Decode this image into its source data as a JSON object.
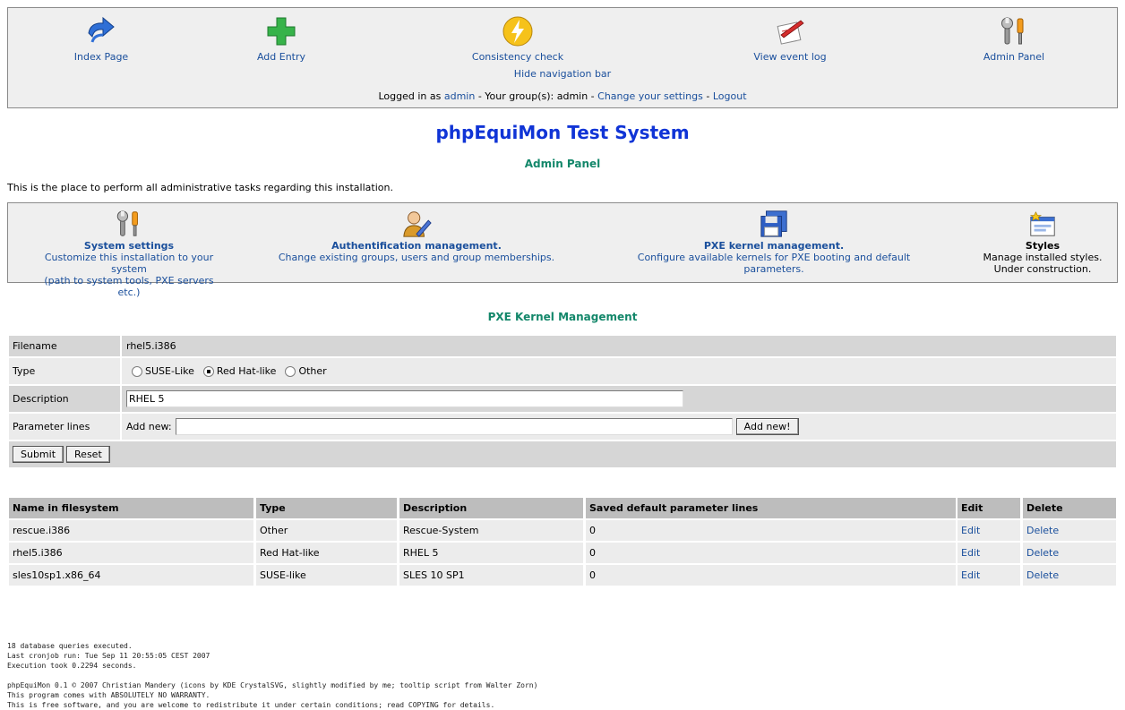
{
  "nav": {
    "items": [
      {
        "label": "Index Page",
        "icon": "arrow-redo-icon"
      },
      {
        "label": "Add Entry",
        "icon": "plus-icon"
      },
      {
        "label": "Consistency check",
        "icon": "lightning-icon"
      },
      {
        "label": "View event log",
        "icon": "edit-document-icon"
      },
      {
        "label": "Admin Panel",
        "icon": "tools-icon"
      }
    ],
    "hide_label": "Hide navigation bar",
    "logged_in_prefix": "Logged in as",
    "user": "admin",
    "groups_text": "- Your group(s): admin -",
    "settings_link": "Change your settings",
    "sep": "-",
    "logout_link": "Logout"
  },
  "page": {
    "title": "phpEquiMon Test System",
    "heading": "Admin Panel",
    "intro": "This is the place to perform all administrative tasks regarding this installation."
  },
  "admin_panels": [
    {
      "title": "System settings",
      "desc1": "Customize this installation to your system",
      "desc2": "(path to system tools, PXE servers etc.)",
      "icon": "tools-icon"
    },
    {
      "title": "Authentification management.",
      "desc1": "Change existing groups, users and group memberships.",
      "desc2": "",
      "icon": "user-edit-icon"
    },
    {
      "title": "PXE kernel management.",
      "desc1": "Configure available kernels for PXE booting and default parameters.",
      "desc2": "",
      "icon": "floppy-disks-icon"
    },
    {
      "title": "Styles",
      "desc1": "Manage installed styles.",
      "desc2": "Under construction.",
      "icon": "window-style-icon"
    }
  ],
  "pxe": {
    "heading": "PXE Kernel Management",
    "form": {
      "filename_label": "Filename",
      "filename_value": "rhel5.i386",
      "type_label": "Type",
      "type_options": [
        "SUSE-Like",
        "Red Hat-like",
        "Other"
      ],
      "type_selected": "Red Hat-like",
      "description_label": "Description",
      "description_value": "RHEL 5",
      "params_label": "Parameter lines",
      "add_new_label": "Add new:",
      "add_new_value": "",
      "add_new_button": "Add new!",
      "submit_button": "Submit",
      "reset_button": "Reset"
    },
    "table": {
      "headers": [
        "Name in filesystem",
        "Type",
        "Description",
        "Saved default parameter lines",
        "Edit",
        "Delete"
      ],
      "rows": [
        [
          "rescue.i386",
          "Other",
          "Rescue-System",
          "0",
          "Edit",
          "Delete"
        ],
        [
          "rhel5.i386",
          "Red Hat-like",
          "RHEL 5",
          "0",
          "Edit",
          "Delete"
        ],
        [
          "sles10sp1.x86_64",
          "SUSE-like",
          "SLES 10 SP1",
          "0",
          "Edit",
          "Delete"
        ]
      ]
    }
  },
  "footer": {
    "lines": [
      "18 database queries executed.",
      "Last cronjob run: Tue Sep 11 20:55:05 CEST 2007",
      "Execution took 0.2294 seconds.",
      "",
      "phpEquiMon 0.1   © 2007 Christian Mandery (icons by KDE CrystalSVG, slightly modified by me; tooltip script from Walter Zorn)",
      "This program comes with ABSOLUTELY NO WARRANTY.",
      "This is free software, and you are welcome to redistribute it under certain conditions; read COPYING for details."
    ]
  },
  "colors": {
    "link": "#1a4f9c",
    "title": "#1034d6",
    "heading": "#13876a",
    "panel_bg": "#efefef"
  }
}
